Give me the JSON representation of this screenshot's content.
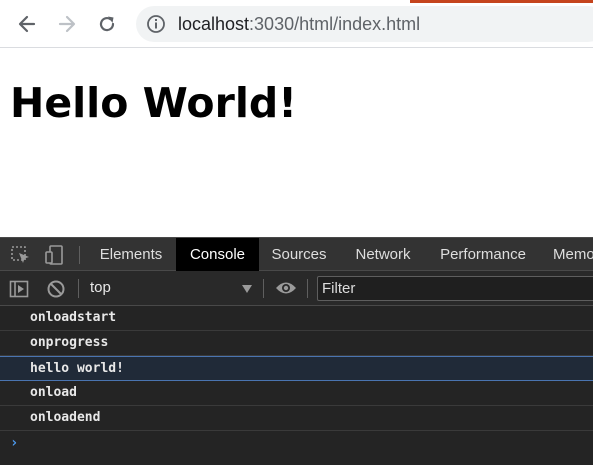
{
  "browser": {
    "url_host": "localhost",
    "url_rest": ":3030/html/index.html",
    "icons": [
      "back-arrow-icon",
      "forward-arrow-icon",
      "reload-icon",
      "info-icon"
    ],
    "tab_accent_color": "#c5441d"
  },
  "page": {
    "heading": "Hello World!"
  },
  "devtools": {
    "tabs": [
      {
        "label": "Elements",
        "active": false
      },
      {
        "label": "Console",
        "active": true
      },
      {
        "label": "Sources",
        "active": false
      },
      {
        "label": "Network",
        "active": false
      },
      {
        "label": "Performance",
        "active": false
      },
      {
        "label": "Memo",
        "active": false
      }
    ],
    "toolbar": {
      "context": "top",
      "filter_placeholder": "Filter",
      "icons": [
        "inspect-element-icon",
        "device-toolbar-icon",
        "sidebar-toggle-icon",
        "clear-console-icon",
        "eye-icon"
      ]
    },
    "console": {
      "messages": [
        {
          "text": "onloadstart",
          "highlighted": false
        },
        {
          "text": "onprogress",
          "highlighted": false
        },
        {
          "text": "hello world!",
          "highlighted": true
        },
        {
          "text": "onload",
          "highlighted": false
        },
        {
          "text": "onloadend",
          "highlighted": false
        }
      ],
      "prompt_symbol": "›",
      "theme_background": "#242424",
      "highlight_color": "#4a74b0"
    }
  }
}
